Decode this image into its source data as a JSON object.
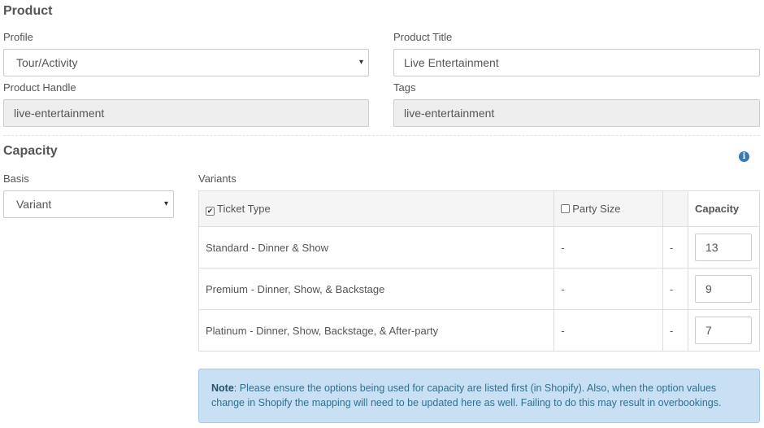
{
  "product": {
    "section_title": "Product",
    "profile": {
      "label": "Profile",
      "value": "Tour/Activity",
      "caret": "▾"
    },
    "title": {
      "label": "Product Title",
      "value": "Live Entertainment"
    },
    "handle": {
      "label": "Product Handle",
      "value": "live-entertainment"
    },
    "tags": {
      "label": "Tags",
      "value": "live-entertainment"
    }
  },
  "capacity": {
    "section_title": "Capacity",
    "info_icon": "info-circle-icon",
    "basis": {
      "label": "Basis",
      "value": "Variant",
      "caret": "▾"
    },
    "variants": {
      "label": "Variants",
      "headers": {
        "ticket_type": "Ticket Type",
        "ticket_type_checked": true,
        "party_size": "Party Size",
        "party_size_checked": false,
        "capacity": "Capacity"
      },
      "rows": [
        {
          "ticket_type": "Standard - Dinner & Show",
          "party_size": "-",
          "extra": "-",
          "capacity": "13"
        },
        {
          "ticket_type": "Premium - Dinner, Show, & Backstage",
          "party_size": "-",
          "extra": "-",
          "capacity": "9"
        },
        {
          "ticket_type": "Platinum - Dinner, Show, Backstage, & After-party",
          "party_size": "-",
          "extra": "-",
          "capacity": "7"
        }
      ]
    },
    "note": {
      "label": "Note",
      "text": ": Please ensure the options being used for capacity are listed first (in Shopify). Also, when the option values change in Shopify the mapping will need to be updated here as well. Failing to do this may result in overbookings."
    }
  },
  "colors": {
    "note_background": "#c9dff3",
    "info_icon": "#337ab7",
    "readonly_field": "#eeeeee"
  }
}
